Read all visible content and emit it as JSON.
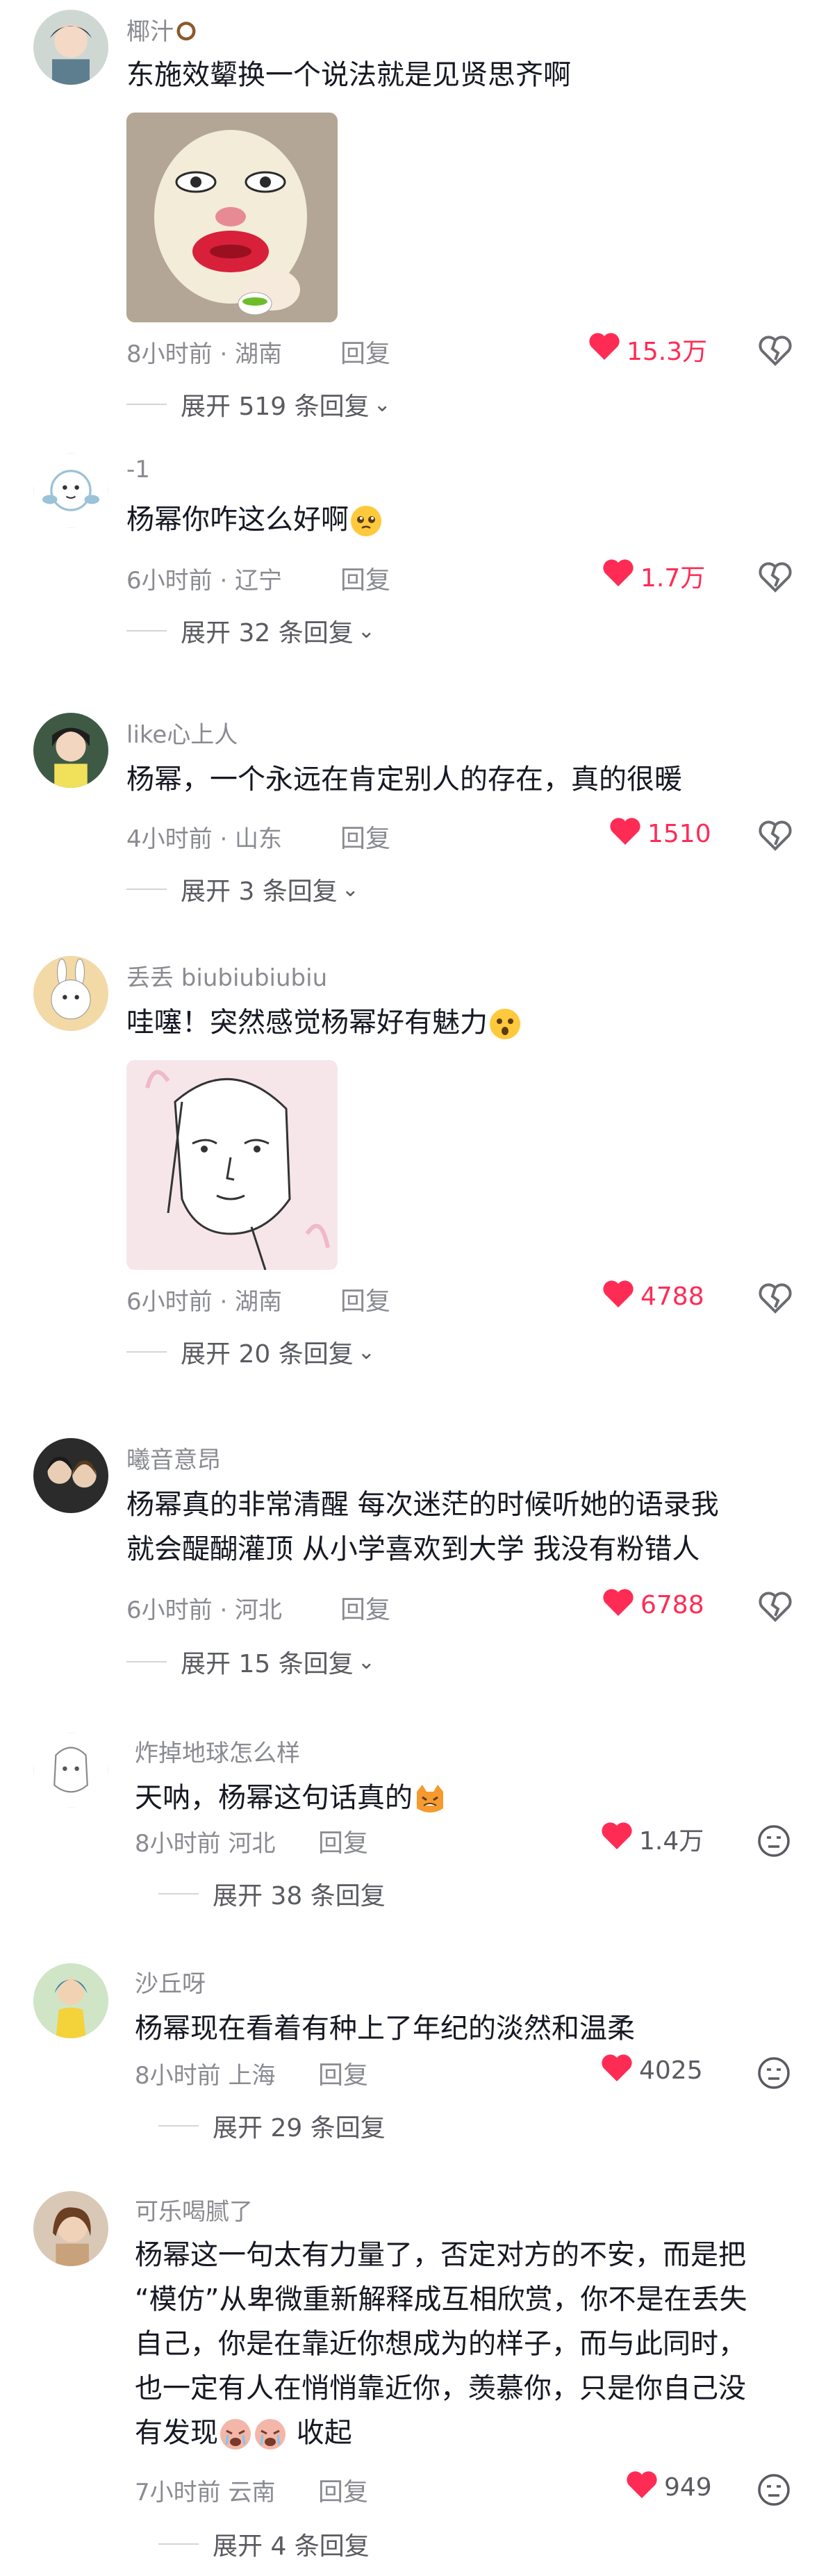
{
  "comments": [
    {
      "author": "椰汁",
      "author_emoji": "coconut-emoji",
      "text": "东施效颦换一个说法就是见贤思齐啊",
      "time_location": "8小时前 · 湖南",
      "reply_label": "回复",
      "likes": "15.3万",
      "liked": true,
      "expand": "展开 519 条回复"
    },
    {
      "author": "-1",
      "text": "杨幂你咋这么好啊",
      "text_emoji": "pleading-face-emoji",
      "time_location": "6小时前 · 辽宁",
      "reply_label": "回复",
      "likes": "1.7万",
      "liked": true,
      "expand": "展开 32 条回复"
    },
    {
      "author": "like心上人",
      "text": "杨幂，一个永远在肯定别人的存在，真的很暖",
      "time_location": "4小时前 · 山东",
      "reply_label": "回复",
      "likes": "1510",
      "liked": true,
      "expand": "展开 3 条回复"
    },
    {
      "author": "丢丢 biubiubiubiu",
      "text": "哇噻！突然感觉杨幂好有魅力",
      "text_emoji": "surprised-face-emoji",
      "time_location": "6小时前 · 湖南",
      "reply_label": "回复",
      "likes": "4788",
      "liked": true,
      "expand": "展开 20 条回复"
    },
    {
      "author": "曦音意昂",
      "text_lines": [
        "杨幂真的非常清醒 每次迷茫的时候听她的语录我",
        "就会醍醐灌顶 从小学喜欢到大学 我没有粉错人"
      ],
      "time_location": "6小时前 · 河北",
      "reply_label": "回复",
      "likes": "6788",
      "liked": true,
      "expand": "展开 15 条回复"
    },
    {
      "author": "炸掉地球怎么样",
      "text": "天呐，杨幂这句话真的",
      "text_emoji": "cat-face-emoji",
      "time": "8小时前",
      "location": "河北",
      "reply_label": "回复",
      "likes": "1.4万",
      "liked": true,
      "expand": "展开 38 条回复"
    },
    {
      "author": "沙丘呀",
      "text": "杨幂现在看着有种上了年纪的淡然和温柔",
      "time": "8小时前",
      "location": "上海",
      "reply_label": "回复",
      "likes": "4025",
      "liked": true,
      "expand": "展开 29 条回复"
    },
    {
      "author": "可乐喝腻了",
      "text_lines": [
        "杨幂这一句太有力量了，否定对方的不安，而是把",
        "“模仿”从卑微重新解释成互相欣赏，你不是在丢失",
        "自己，你是在靠近你想成为的样子，而与此同时，",
        "也一定有人在悄悄靠近你，羡慕你，只是你自己没",
        "有发现"
      ],
      "collapse_label": "收起",
      "time": "7小时前",
      "location": "云南",
      "reply_label": "回复",
      "likes": "949",
      "liked": true,
      "expand": "展开 4 条回复"
    }
  ],
  "colors": {
    "like_red": "#fe2c55",
    "meta_gray": "#8a8b91",
    "text_dark": "#161823"
  }
}
